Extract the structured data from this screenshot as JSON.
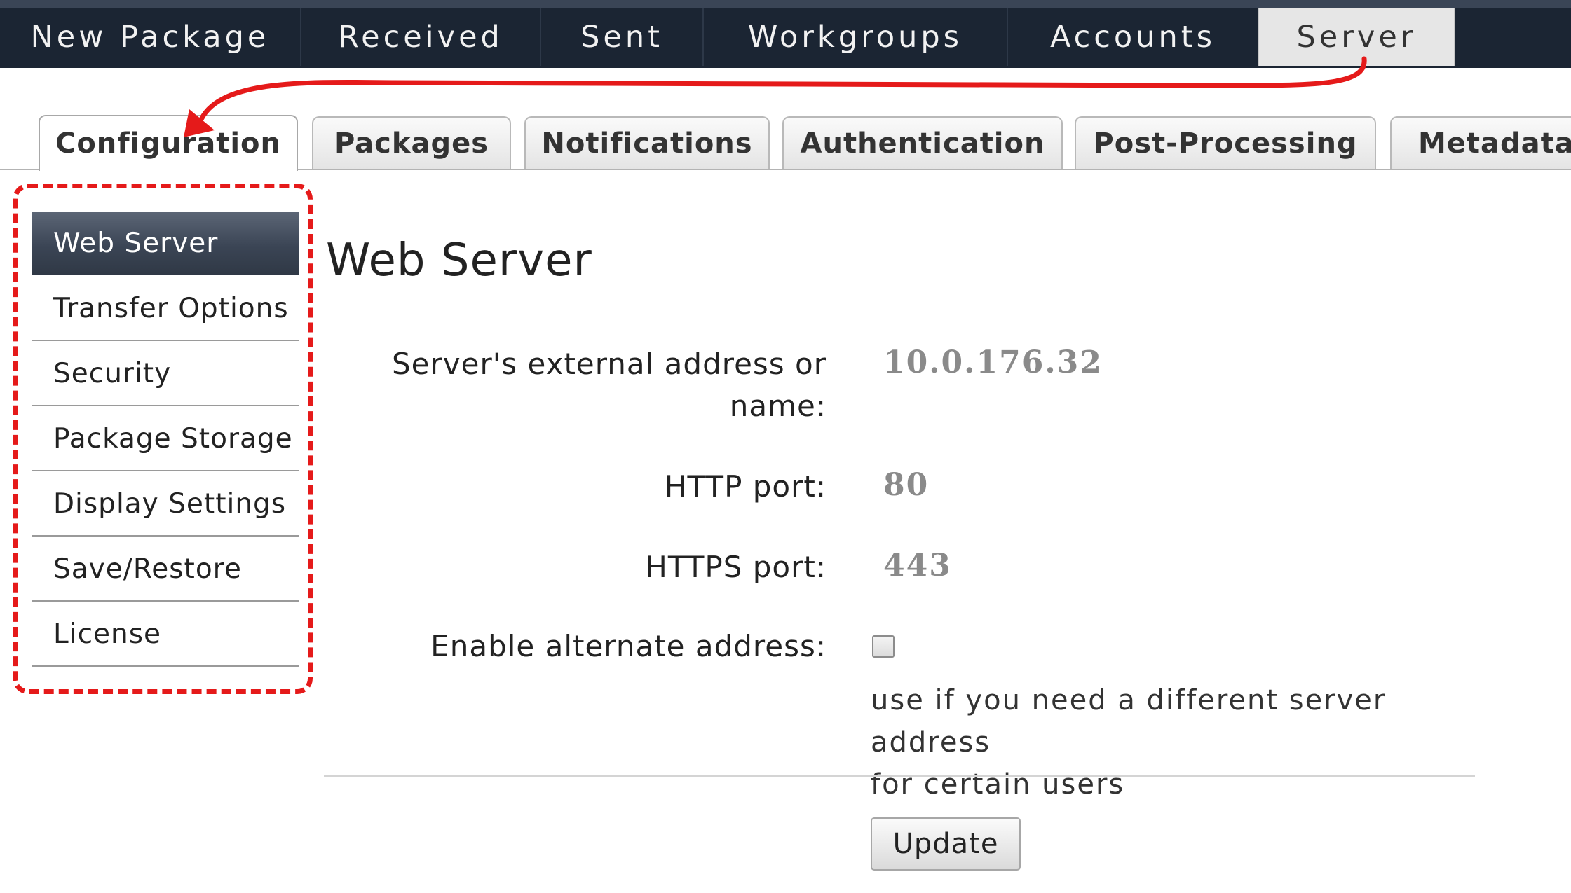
{
  "top_nav": {
    "items": [
      {
        "label": "New Package"
      },
      {
        "label": "Received"
      },
      {
        "label": "Sent"
      },
      {
        "label": "Workgroups"
      },
      {
        "label": "Accounts"
      },
      {
        "label": "Server",
        "active": true
      }
    ]
  },
  "sub_tabs": [
    {
      "label": "Configuration",
      "active": true
    },
    {
      "label": "Packages"
    },
    {
      "label": "Notifications"
    },
    {
      "label": "Authentication"
    },
    {
      "label": "Post-Processing"
    },
    {
      "label": "Metadata"
    }
  ],
  "sidebar": {
    "items": [
      {
        "label": "Web Server",
        "active": true
      },
      {
        "label": "Transfer Options"
      },
      {
        "label": "Security"
      },
      {
        "label": "Package Storage"
      },
      {
        "label": "Display Settings"
      },
      {
        "label": "Save/Restore"
      },
      {
        "label": "License"
      }
    ]
  },
  "main": {
    "title": "Web Server",
    "fields": {
      "external_address": {
        "label_line1": "Server's external address or",
        "label_line2": "name:",
        "value": "10.0.176.32"
      },
      "http_port": {
        "label": "HTTP port:",
        "value": "80"
      },
      "https_port": {
        "label": "HTTPS port:",
        "value": "443"
      },
      "alternate_address": {
        "label": "Enable alternate address:",
        "checked": false,
        "help_line1": "use if you need a different server address",
        "help_line2": "for certain users"
      }
    },
    "update_label": "Update"
  },
  "colors": {
    "nav_background": "#1b2533",
    "sidebar_active": "#3b4555",
    "annotation_red": "#e51a1a",
    "value_gray": "#8a8a8a"
  },
  "icons": {
    "callout_arrow": "curved-arrow-icon",
    "checkbox": "checkbox-icon"
  }
}
